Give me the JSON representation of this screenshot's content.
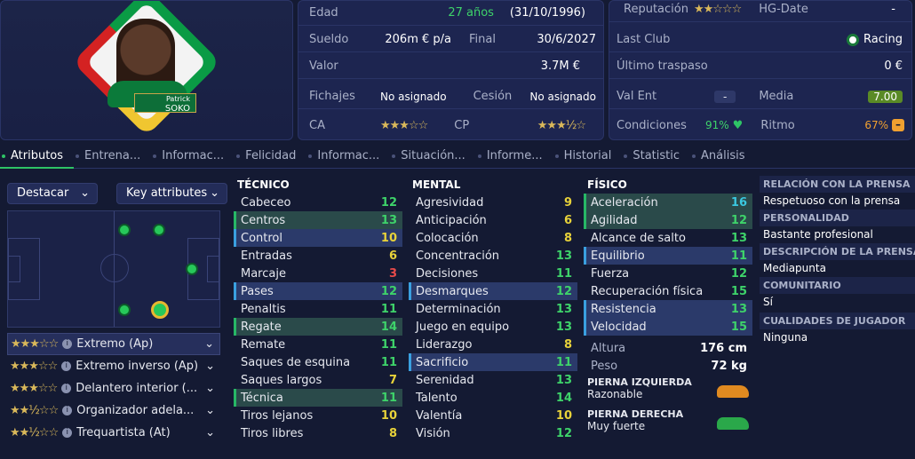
{
  "player": {
    "first_name": "Patrick",
    "last_name": "SOKO"
  },
  "info": {
    "age_label": "Edad",
    "age_value": "27 años",
    "birthdate": "(31/10/1996)",
    "salary_label": "Sueldo",
    "salary_value": "206m € p/a",
    "end_label": "Final",
    "end_value": "30/6/2027",
    "value_label": "Valor",
    "value_value": "3.7M €",
    "signings_label": "Fichajes",
    "signings_value": "No asignado",
    "loan_label": "Cesión",
    "loan_value": "No asignado",
    "ca_label": "CA",
    "ca_stars": "★★★☆☆",
    "cp_label": "CP",
    "cp_stars": "★★★½☆"
  },
  "info2": {
    "rep_label": "Reputación",
    "rep_stars": "★★☆☆☆",
    "hg_label": "HG-Date",
    "hg_value": "-",
    "last_club_label": "Last Club",
    "last_club_value": "Racing",
    "last_transfer_label": "Último traspaso",
    "last_transfer_value": "0 €",
    "valent_label": "Val Ent",
    "valent_value": "-",
    "media_label": "Media",
    "media_value": "7.00",
    "cond_label": "Condiciones",
    "cond_value": "91%",
    "ritmo_label": "Ritmo",
    "ritmo_value": "67%"
  },
  "tabs": [
    "Atributos",
    "Entrena...",
    "Informac...",
    "Felicidad",
    "Informac...",
    "Situación...",
    "Informe...",
    "Historial",
    "Statistic",
    "Análisis"
  ],
  "controls": {
    "highlight_label": "Destacar",
    "key_attrs_label": "Key attributes"
  },
  "roles": [
    {
      "stars": "★★★☆☆",
      "name": "Extremo (Ap)"
    },
    {
      "stars": "★★★☆☆",
      "name": "Extremo inverso (Ap)"
    },
    {
      "stars": "★★★☆☆",
      "name": "Delantero interior (..."
    },
    {
      "stars": "★★½☆☆",
      "name": "Organizador adela..."
    },
    {
      "stars": "★★½☆☆",
      "name": "Trequartista (At)"
    }
  ],
  "technical": {
    "title": "TÉCNICO",
    "attrs": [
      {
        "name": "Cabeceo",
        "value": "12"
      },
      {
        "name": "Centros",
        "value": "13"
      },
      {
        "name": "Control",
        "value": "10"
      },
      {
        "name": "Entradas",
        "value": "6"
      },
      {
        "name": "Marcaje",
        "value": "3"
      },
      {
        "name": "Pases",
        "value": "12"
      },
      {
        "name": "Penaltis",
        "value": "11"
      },
      {
        "name": "Regate",
        "value": "14"
      },
      {
        "name": "Remate",
        "value": "11"
      },
      {
        "name": "Saques de esquina",
        "value": "11"
      },
      {
        "name": "Saques largos",
        "value": "7"
      },
      {
        "name": "Técnica",
        "value": "11"
      },
      {
        "name": "Tiros lejanos",
        "value": "10"
      },
      {
        "name": "Tiros libres",
        "value": "8"
      }
    ]
  },
  "mental": {
    "title": "MENTAL",
    "attrs": [
      {
        "name": "Agresividad",
        "value": "9"
      },
      {
        "name": "Anticipación",
        "value": "6"
      },
      {
        "name": "Colocación",
        "value": "8"
      },
      {
        "name": "Concentración",
        "value": "13"
      },
      {
        "name": "Decisiones",
        "value": "11"
      },
      {
        "name": "Desmarques",
        "value": "12"
      },
      {
        "name": "Determinación",
        "value": "13"
      },
      {
        "name": "Juego en equipo",
        "value": "13"
      },
      {
        "name": "Liderazgo",
        "value": "8"
      },
      {
        "name": "Sacrificio",
        "value": "11"
      },
      {
        "name": "Serenidad",
        "value": "13"
      },
      {
        "name": "Talento",
        "value": "14"
      },
      {
        "name": "Valentía",
        "value": "10"
      },
      {
        "name": "Visión",
        "value": "12"
      }
    ]
  },
  "physical": {
    "title": "FÍSICO",
    "attrs": [
      {
        "name": "Aceleración",
        "value": "16"
      },
      {
        "name": "Agilidad",
        "value": "12"
      },
      {
        "name": "Alcance de salto",
        "value": "13"
      },
      {
        "name": "Equilibrio",
        "value": "11"
      },
      {
        "name": "Fuerza",
        "value": "12"
      },
      {
        "name": "Recuperación física",
        "value": "15"
      },
      {
        "name": "Resistencia",
        "value": "13"
      },
      {
        "name": "Velocidad",
        "value": "15"
      }
    ],
    "height_label": "Altura",
    "height_value": "176 cm",
    "weight_label": "Peso",
    "weight_value": "72 kg",
    "left_foot_label": "PIERNA IZQUIERDA",
    "left_foot_value": "Razonable",
    "right_foot_label": "PIERNA DERECHA",
    "right_foot_value": "Muy fuerte"
  },
  "side": {
    "relation_label": "RELACIÓN CON LA PRENSA",
    "relation_value": "Respetuoso con la prensa",
    "personality_label": "PERSONALIDAD",
    "personality_value": "Bastante profesional",
    "desc_label": "DESCRIPCIÓN DE LA PRENSA",
    "desc_value": "Mediapunta",
    "community_label": "COMUNITARIO",
    "community_value": "Sí",
    "qualities_label": "CUALIDADES DE JUGADOR",
    "qualities_value": "Ninguna"
  }
}
